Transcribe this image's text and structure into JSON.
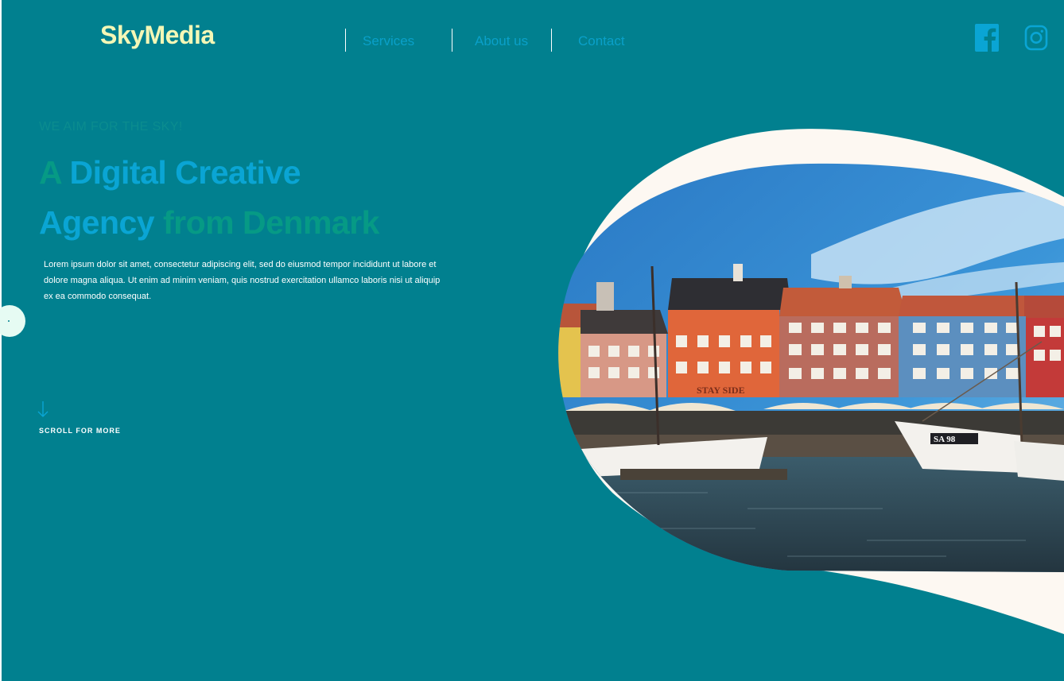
{
  "brand": {
    "logo": "SkyMedia"
  },
  "nav": {
    "items": [
      {
        "label": "Services"
      },
      {
        "label": "About us"
      },
      {
        "label": "Contact"
      }
    ]
  },
  "social": {
    "icons": [
      "facebook-icon",
      "instagram-icon"
    ]
  },
  "hero": {
    "eyebrow": "WE AIM FOR THE SKY!",
    "headline_line1_a": "A",
    "headline_line1_b": "Digital Creative",
    "headline_line2_a": "Agency",
    "headline_line2_b": "from Denmark",
    "body": "Lorem ipsum dolor sit amet, consectetur adipiscing elit, sed do eiusmod tempor incididunt ut labore et dolore magna aliqua. Ut enim ad minim veniam, quis nostrud exercitation ullamco laboris nisi ut aliquip ex ea commodo consequat.",
    "scroll_label": "SCROLL FOR MORE",
    "image_sign": "STAY SIDE",
    "boat_label": "SA 98"
  },
  "colors": {
    "background": "#01808f",
    "logo": "#f4f7b6",
    "nav_link": "#0aa0c9",
    "headline_blue": "#0aa5d4",
    "headline_green": "#069a85",
    "blob": "#fdf8f2"
  }
}
